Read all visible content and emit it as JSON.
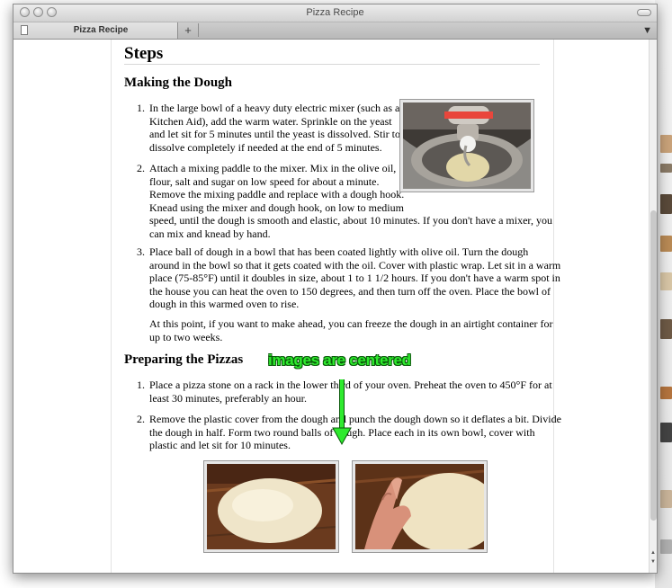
{
  "window": {
    "title": "Pizza Recipe",
    "tab_label": "Pizza Recipe",
    "new_tab_symbol": "+"
  },
  "icons": [
    "close-icon",
    "minimize-icon",
    "zoom-icon",
    "page-icon",
    "bookmark-icon",
    "scroll-up-icon",
    "scroll-down-icon"
  ],
  "colors": {
    "annotation": "#2eea2e",
    "text": "#000000"
  },
  "recipe": {
    "heading": "Steps",
    "sections": [
      {
        "title": "Making the Dough",
        "steps": [
          {
            "number": "1.",
            "lines": [
              "In the large bowl of a heavy duty electric mixer (such as a",
              "Kitchen Aid), add the warm water. Sprinkle on the yeast",
              "and let sit for 5 minutes until the yeast is dissolved. Stir to",
              "dissolve completely if needed at the end of 5 minutes."
            ]
          },
          {
            "number": "2.",
            "lines": [
              "Attach a mixing paddle to the mixer. Mix in the olive oil,",
              "flour, salt and sugar on low speed for about a minute.",
              "Remove the mixing paddle and replace with a dough hook.",
              "Knead using the mixer and dough hook, on low to medium",
              "speed, until the dough is smooth and elastic, about 10 minutes. If you don't have a mixer, you",
              "can mix and knead by hand."
            ]
          },
          {
            "number": "3.",
            "lines": [
              "Place ball of dough in a bowl that has been coated lightly with olive oil. Turn the dough",
              "around in the bowl so that it gets coated with the oil. Cover with plastic wrap. Let sit in a warm",
              "place (75-85°F) until it doubles in size, about 1 to 1 1/2 hours. If you don't have a warm spot in",
              "the house you can heat the oven to 150 degrees, and then turn off the oven. Place the bowl of",
              "dough in this warmed oven to rise."
            ],
            "extra_lines": [
              "At this point, if you want to make ahead, you can freeze the dough in an airtight container for",
              "up to two weeks."
            ]
          }
        ]
      },
      {
        "title": "Preparing the Pizzas",
        "steps": [
          {
            "number": "1.",
            "lines": [
              "Place a pizza stone on a rack in the lower third of your oven. Preheat the oven to 450°F for at",
              "least 30 minutes, preferably an hour."
            ]
          },
          {
            "number": "2.",
            "lines": [
              "Remove the plastic cover from the dough and punch the dough down so it deflates a bit. Divide",
              "the dough in half. Form two round balls of dough. Place each in its own bowl, cover with",
              "plastic and let sit for 10 minutes."
            ]
          }
        ]
      }
    ]
  },
  "annotation": {
    "text": "images are centered"
  }
}
